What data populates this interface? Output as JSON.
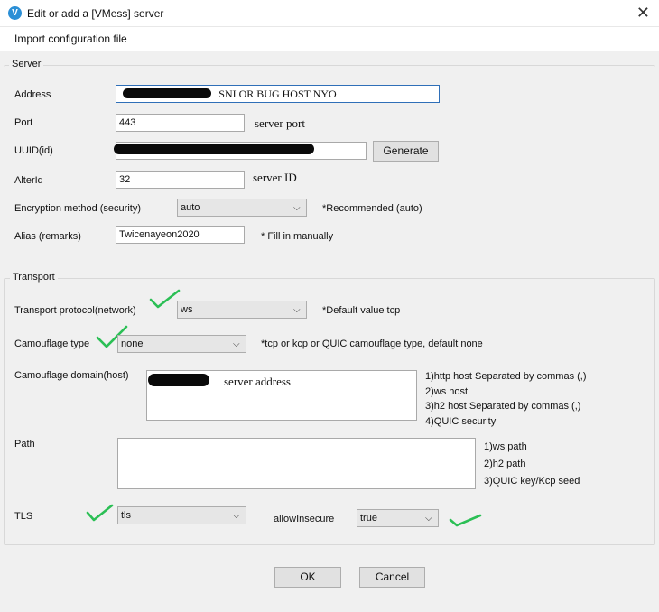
{
  "window": {
    "title": "Edit or add a [VMess] server",
    "icon": "v2ray-app-icon",
    "close": "✕"
  },
  "menu": {
    "import": "Import configuration file"
  },
  "server": {
    "legend": "Server",
    "address_label": "Address",
    "address_value": "SNI OR BUG HOST NYO",
    "port_label": "Port",
    "port_value": "443",
    "port_note": "server port",
    "uuid_label": "UUID(id)",
    "uuid_value": "",
    "generate_label": "Generate",
    "alterid_label": "AlterId",
    "alterid_value": "32",
    "alterid_note": "server ID",
    "encryption_label": "Encryption method (security)",
    "encryption_value": "auto",
    "encryption_note": "*Recommended (auto)",
    "alias_label": "Alias (remarks)",
    "alias_value": "Twicenayeon2020",
    "alias_note": "* Fill in manually"
  },
  "transport": {
    "legend": "Transport",
    "protocol_label": "Transport protocol(network)",
    "protocol_value": "ws",
    "protocol_note": "*Default value tcp",
    "camouflage_label": "Camouflage type",
    "camouflage_value": "none",
    "camouflage_note": "*tcp or kcp or QUIC camouflage type, default none",
    "domain_label": "Camouflage domain(host)",
    "domain_value": "server address",
    "domain_notes": [
      "1)http host Separated by commas (,)",
      "2)ws host",
      "3)h2 host Separated by commas (,)",
      "4)QUIC security"
    ],
    "path_label": "Path",
    "path_notes": [
      "1)ws path",
      "2)h2 path",
      "3)QUIC key/Kcp seed"
    ],
    "tls_label": "TLS",
    "tls_value": "tls",
    "allow_insecure_label": "allowInsecure",
    "allow_insecure_value": "true"
  },
  "footer": {
    "ok": "OK",
    "cancel": "Cancel"
  },
  "colors": {
    "accent": "#2f6fb8",
    "check": "#2bbf55",
    "scribble": "#0a0a0a"
  }
}
